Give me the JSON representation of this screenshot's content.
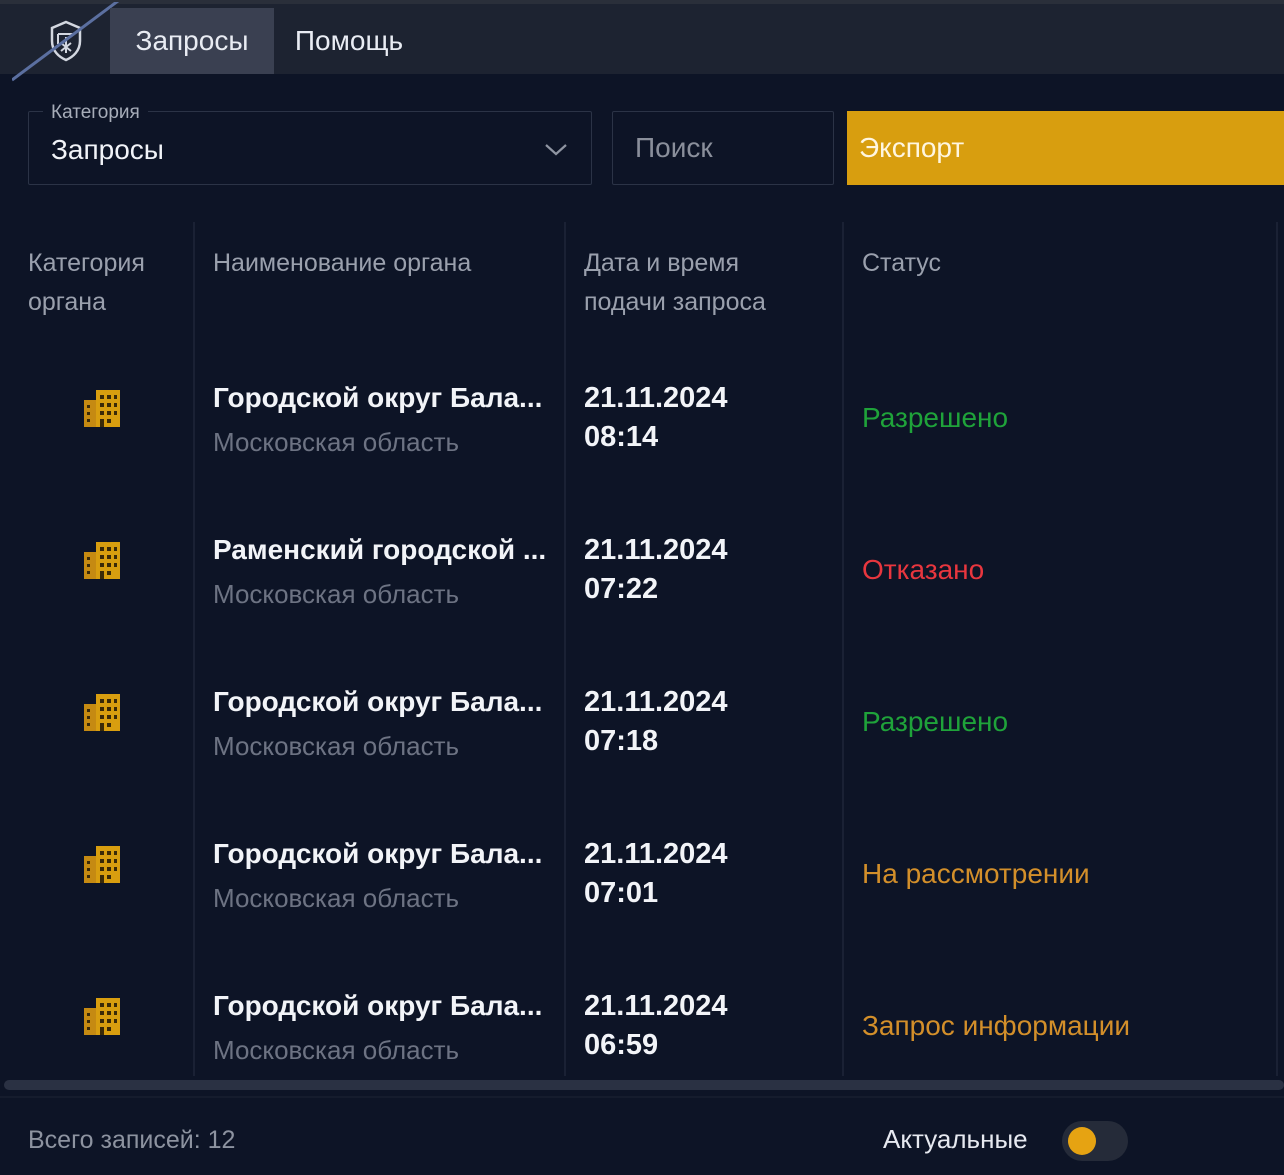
{
  "nav": {
    "logo_icon": "shield-emblem-icon",
    "tabs": [
      {
        "label": "Запросы",
        "active": true
      },
      {
        "label": "Помощь",
        "active": false
      }
    ]
  },
  "filters": {
    "category_label": "Категория",
    "category_value": "Запросы",
    "search_placeholder": "Поиск",
    "search_value": "",
    "export_label": "Экспорт"
  },
  "table": {
    "headers": {
      "category": "Категория органа",
      "name": "Наименование органа",
      "datetime": "Дата и время подачи запроса",
      "status": "Статус"
    },
    "rows": [
      {
        "icon": "building-icon",
        "name": "Городской округ Бала...",
        "region": "Московская область",
        "date": "21.11.2024",
        "time": "08:14",
        "status": "Разрешено",
        "status_color": "#1fa33a"
      },
      {
        "icon": "building-icon",
        "name": "Раменский городской ...",
        "region": "Московская область",
        "date": "21.11.2024",
        "time": "07:22",
        "status": "Отказано",
        "status_color": "#e8363e"
      },
      {
        "icon": "building-icon",
        "name": "Городской округ Бала...",
        "region": "Московская область",
        "date": "21.11.2024",
        "time": "07:18",
        "status": "Разрешено",
        "status_color": "#1fa33a"
      },
      {
        "icon": "building-icon",
        "name": "Городской округ Бала...",
        "region": "Московская область",
        "date": "21.11.2024",
        "time": "07:01",
        "status": "На рассмотрении",
        "status_color": "#d38f2a"
      },
      {
        "icon": "building-icon",
        "name": "Городской округ Бала...",
        "region": "Московская область",
        "date": "21.11.2024",
        "time": "06:59",
        "status": "Запрос информации",
        "status_color": "#d38f2a"
      }
    ]
  },
  "footer": {
    "total_label": "Всего записей: 12",
    "toggle_label": "Актуальные",
    "toggle_on": true
  },
  "colors": {
    "accent": "#d89e0f",
    "background": "#0d1426"
  }
}
